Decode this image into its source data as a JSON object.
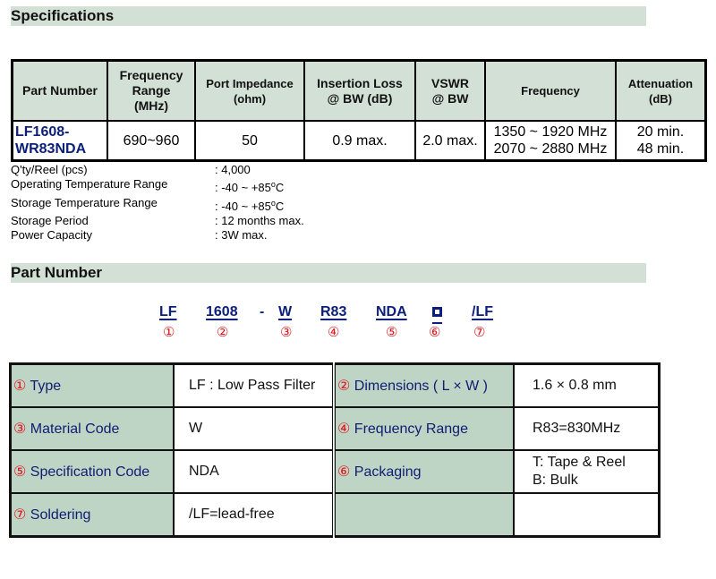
{
  "sections": {
    "specifications": "Specifications",
    "part_number": "Part Number"
  },
  "spec_table": {
    "headers": {
      "part_number": "Part Number",
      "freq_range_1": "Frequency",
      "freq_range_2": "Range",
      "freq_range_3": "(MHz)",
      "impedance_1": "Port Impedance",
      "impedance_2": "(ohm)",
      "insertion_1": "Insertion Loss",
      "insertion_2": "@ BW (dB)",
      "vswr_1": "VSWR",
      "vswr_2": "@ BW",
      "frequency": "Frequency",
      "attenuation_1": "Attenuation",
      "attenuation_2": "(dB)"
    },
    "row": {
      "part_number_1": "LF1608-",
      "part_number_2": "WR83NDA",
      "freq_range": "690~960",
      "impedance": "50",
      "insertion_loss": "0.9 max.",
      "vswr": "2.0 max.",
      "frequency_1": "1350 ~ 1920 MHz",
      "frequency_2": "2070 ~ 2880 MHz",
      "attenuation_1": "20 min.",
      "attenuation_2": "48 min."
    }
  },
  "properties": [
    {
      "key": "Q'ty/Reel (pcs)",
      "value": ": 4,000"
    },
    {
      "key": "Operating Temperature Range",
      "value": ": -40 ~ +85",
      "unit_sup": "o",
      "unit": "C"
    },
    {
      "key": "Storage Temperature Range",
      "value": ": -40 ~ +85",
      "unit_sup": "o",
      "unit": "C"
    },
    {
      "key": "Storage Period",
      "value": ": 12 months max."
    },
    {
      "key": "Power Capacity",
      "value": ": 3W max."
    }
  ],
  "part_code": {
    "segments": [
      "LF",
      "1608",
      "W",
      "R83",
      "NDA",
      "",
      "/LF"
    ],
    "dash": "-",
    "numbers": [
      "①",
      "②",
      "③",
      "④",
      "⑤",
      "⑥",
      "⑦"
    ]
  },
  "part_table": {
    "rows": [
      {
        "n1": "①",
        "label1": " Type",
        "value1": "LF : Low Pass Filter",
        "n2": "②",
        "label2": " Dimensions ( L × W )",
        "value2": "1.6 × 0.8 mm"
      },
      {
        "n1": "③",
        "label1": " Material Code",
        "value1": "W",
        "n2": "④",
        "label2": " Frequency Range",
        "value2": "R83=830MHz"
      },
      {
        "n1": "⑤",
        "label1": " Specification Code",
        "value1": "NDA",
        "n2": "⑥",
        "label2": " Packaging",
        "value2a": "T: Tape & Reel",
        "value2b": "B: Bulk"
      },
      {
        "n1": "⑦",
        "label1": " Soldering",
        "value1": "/LF=lead-free",
        "n2": "",
        "label2": "",
        "value2": ""
      }
    ]
  }
}
